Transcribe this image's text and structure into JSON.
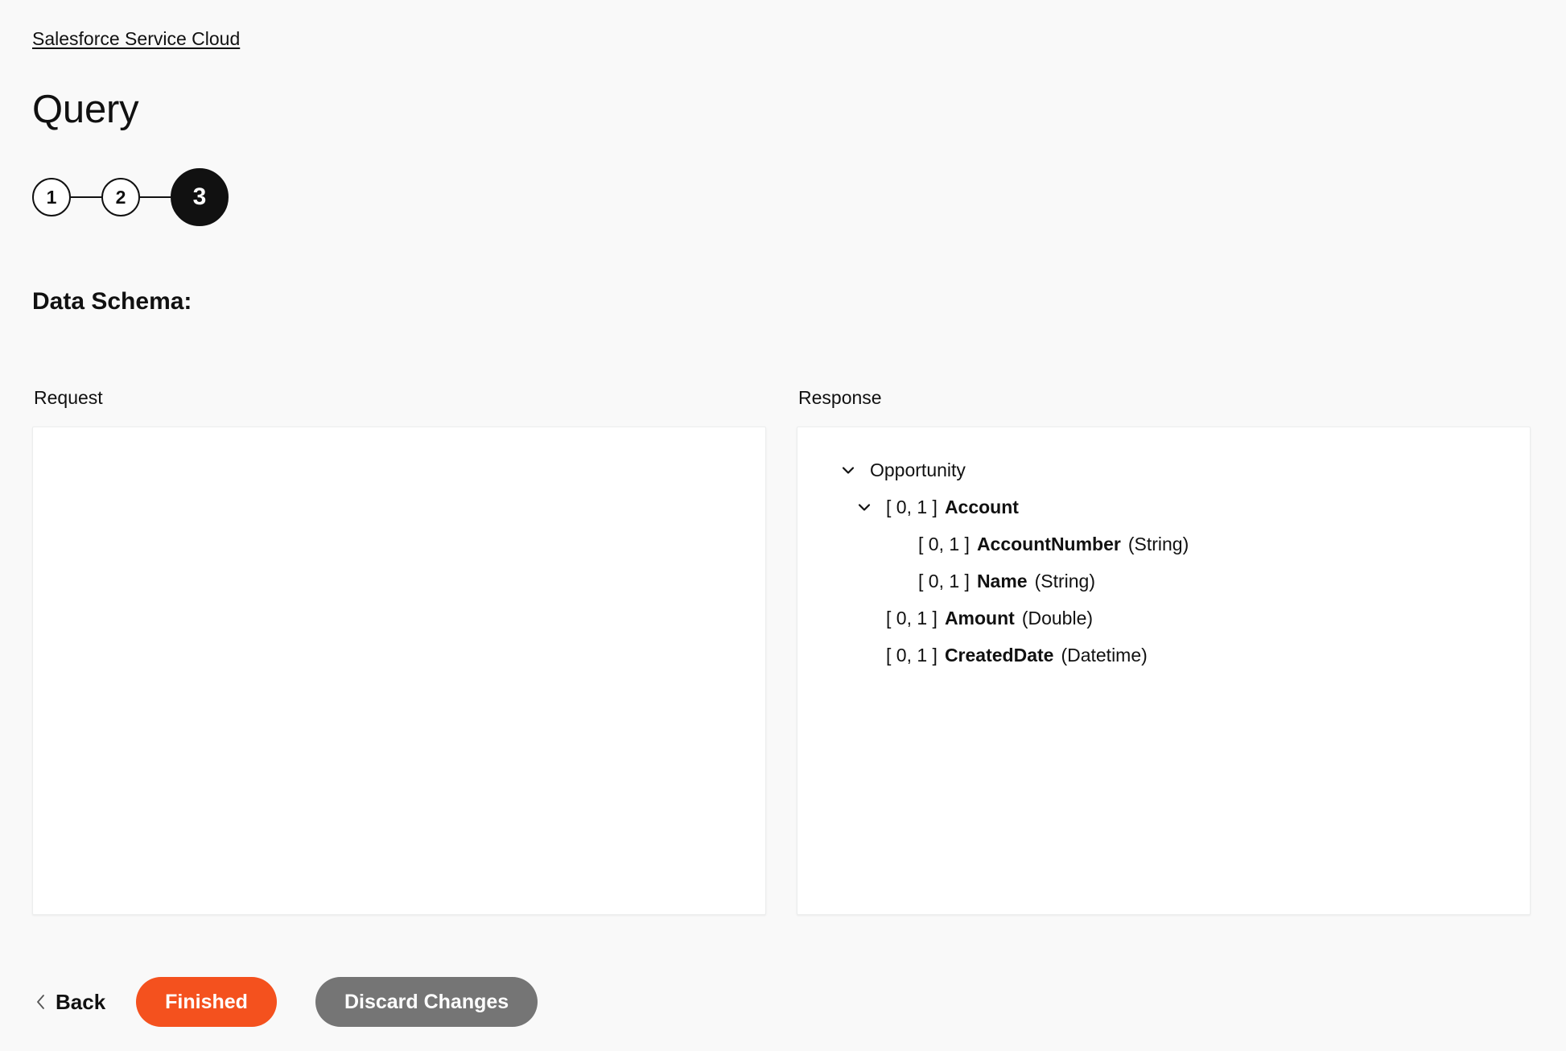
{
  "breadcrumb": {
    "label": "Salesforce Service Cloud"
  },
  "header": {
    "title": "Query"
  },
  "stepper": {
    "steps": [
      {
        "label": "1",
        "state": "inactive"
      },
      {
        "label": "2",
        "state": "inactive"
      },
      {
        "label": "3",
        "state": "active"
      }
    ]
  },
  "section": {
    "heading": "Data Schema:"
  },
  "panels": {
    "request": {
      "label": "Request",
      "tree": []
    },
    "response": {
      "label": "Response",
      "tree": [
        {
          "depth": 0,
          "expandable": true,
          "expanded": true,
          "chevron": "chevron-down-icon",
          "cardinality": "",
          "name": "Opportunity",
          "bold": false,
          "type": ""
        },
        {
          "depth": 1,
          "expandable": true,
          "expanded": true,
          "chevron": "chevron-down-icon",
          "cardinality": "[ 0, 1 ]",
          "name": "Account",
          "bold": true,
          "type": ""
        },
        {
          "depth": 2,
          "expandable": false,
          "expanded": false,
          "chevron": "",
          "cardinality": "[ 0, 1 ]",
          "name": "AccountNumber",
          "bold": true,
          "type": "(String)"
        },
        {
          "depth": 2,
          "expandable": false,
          "expanded": false,
          "chevron": "",
          "cardinality": "[ 0, 1 ]",
          "name": "Name",
          "bold": true,
          "type": "(String)"
        },
        {
          "depth": 1,
          "expandable": false,
          "expanded": false,
          "chevron": "",
          "cardinality": "[ 0, 1 ]",
          "name": "Amount",
          "bold": true,
          "type": "(Double)"
        },
        {
          "depth": 1,
          "expandable": false,
          "expanded": false,
          "chevron": "",
          "cardinality": "[ 0, 1 ]",
          "name": "CreatedDate",
          "bold": true,
          "type": "(Datetime)"
        }
      ]
    }
  },
  "footer": {
    "back_label": "Back",
    "back_icon": "chevron-left-icon",
    "finished_label": "Finished",
    "discard_label": "Discard Changes"
  },
  "colors": {
    "page_background": "#f9f9f9",
    "panel_background": "#ffffff",
    "panel_border": "#eceded",
    "text": "#111111",
    "primary_button": "#f4511e",
    "secondary_button": "#757575",
    "step_active": "#111111"
  }
}
